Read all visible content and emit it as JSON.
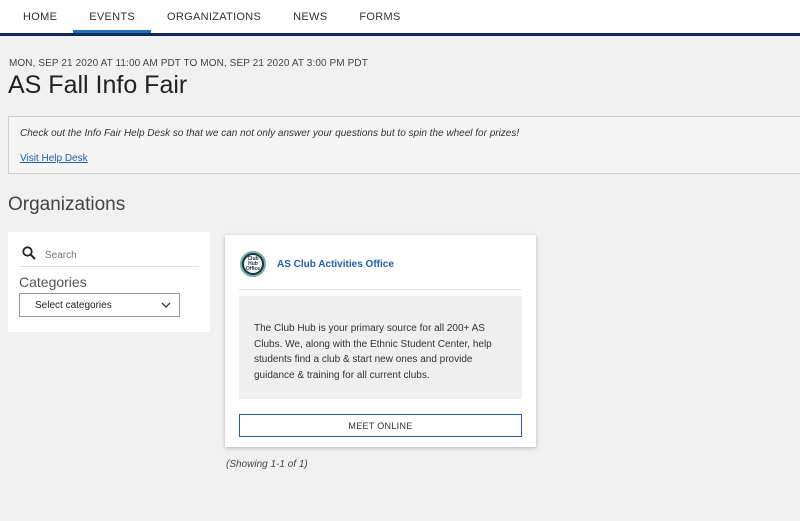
{
  "nav": {
    "items": [
      {
        "label": "HOME"
      },
      {
        "label": "EVENTS"
      },
      {
        "label": "ORGANIZATIONS"
      },
      {
        "label": "NEWS"
      },
      {
        "label": "FORMS"
      }
    ],
    "active": "EVENTS"
  },
  "event": {
    "date_range": "MON, SEP 21 2020 AT 11:00 AM PDT TO MON, SEP 21 2020 AT 3:00 PM PDT",
    "title": "AS Fall Info Fair",
    "info_text": "Check out the Info Fair Help Desk so that we can not only answer your questions but to spin the wheel for prizes!",
    "help_link": "Visit Help Desk"
  },
  "organizations": {
    "section_title": "Organizations",
    "search": {
      "placeholder": "Search",
      "value": ""
    },
    "categories_label": "Categories",
    "categories_select": "Select categories",
    "cards": [
      {
        "name": "AS Club Activities Office",
        "logo_text": "Club Hub Office",
        "description": "The Club Hub is your primary source for all 200+ AS Clubs. We, along with the Ethnic Student Center, help students find a club & start new ones and provide guidance & training for all current clubs.",
        "button_label": "MEET ONLINE"
      }
    ],
    "showing_text": "(Showing 1-1 of 1)"
  },
  "colors": {
    "nav_border": "#0c2a5a",
    "accent": "#1f5fb0",
    "active_tab_underline": "#1f6fbf",
    "page_bg": "#f1f1f1"
  },
  "icons": {
    "search": "search-icon",
    "select": "chevron-down-icon"
  }
}
